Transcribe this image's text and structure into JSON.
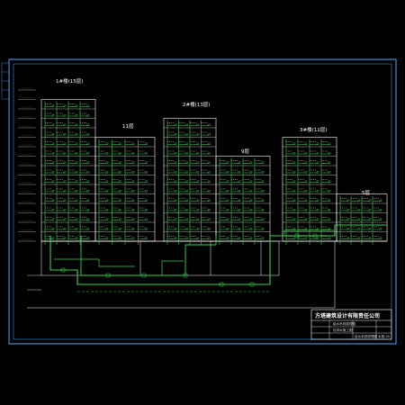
{
  "drawing": {
    "background": "#000000",
    "frame_color": "#3a8fd6",
    "building_color": "#ffffff",
    "pipe_color": "#39d353",
    "text_color": "#ffffff"
  },
  "buildings": [
    {
      "label": "1#楼(15层)",
      "floors": 15
    },
    {
      "label": "11层",
      "floors": 11
    },
    {
      "label": "2#楼(13层)",
      "floors": 13
    },
    {
      "label": "9层",
      "floors": 9
    },
    {
      "label": "3#楼(11层)",
      "floors": 11
    },
    {
      "label": "5层",
      "floors": 5
    }
  ],
  "title_block": {
    "company": "方塔建筑设计有限责任公司",
    "row1": "給水系统原理图",
    "row2": "给排水施工图",
    "drawing_name": "给水系统原理图",
    "sheet": "水施-05"
  }
}
